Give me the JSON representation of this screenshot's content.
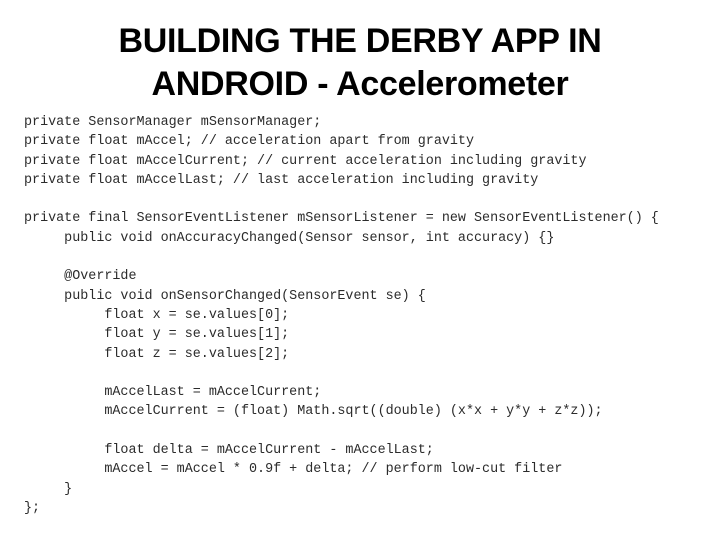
{
  "slide": {
    "title_line1": "BUILDING THE DERBY APP IN",
    "title_line2": "ANDROID - Accelerometer"
  },
  "code": {
    "lines": [
      "private SensorManager mSensorManager;",
      "private float mAccel; // acceleration apart from gravity",
      "private float mAccelCurrent; // current acceleration including gravity",
      "private float mAccelLast; // last acceleration including gravity",
      "",
      "private final SensorEventListener mSensorListener = new SensorEventListener() {",
      "     public void onAccuracyChanged(Sensor sensor, int accuracy) {}",
      "",
      "     @Override",
      "     public void onSensorChanged(SensorEvent se) {",
      "          float x = se.values[0];",
      "          float y = se.values[1];",
      "          float z = se.values[2];",
      "",
      "          mAccelLast = mAccelCurrent;",
      "          mAccelCurrent = (float) Math.sqrt((double) (x*x + y*y + z*z));",
      "",
      "          float delta = mAccelCurrent - mAccelLast;",
      "          mAccel = mAccel * 0.9f + delta; // perform low-cut filter",
      "     }",
      "};"
    ]
  }
}
